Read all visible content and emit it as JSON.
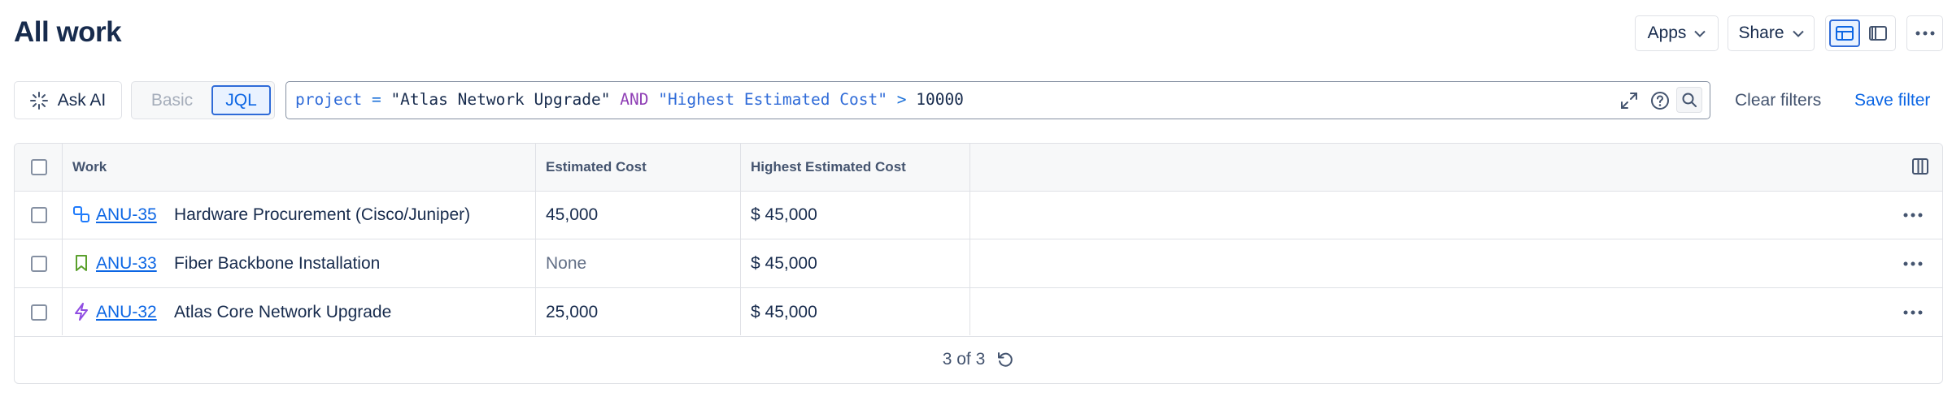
{
  "header": {
    "title": "All work",
    "apps_label": "Apps",
    "share_label": "Share"
  },
  "filter_bar": {
    "ask_ai_label": "Ask AI",
    "basic_label": "Basic",
    "jql_label": "JQL",
    "query": {
      "field1": "project",
      "op1": "=",
      "value1": "\"Atlas Network Upgrade\"",
      "conj": "AND",
      "field2": "\"Highest Estimated Cost\"",
      "op2": ">",
      "value2": "10000"
    },
    "clear_filters_label": "Clear filters",
    "save_filter_label": "Save filter"
  },
  "table": {
    "columns": [
      "Work",
      "Estimated Cost",
      "Highest Estimated Cost"
    ],
    "rows": [
      {
        "type_icon": "subtask-icon",
        "key": "ANU-35",
        "summary": "Hardware Procurement (Cisco/Juniper)",
        "estimated_cost": "45,000",
        "highest_estimated_cost": "$ 45,000"
      },
      {
        "type_icon": "story-icon",
        "key": "ANU-33",
        "summary": "Fiber Backbone Installation",
        "estimated_cost": "None",
        "highest_estimated_cost": "$ 45,000"
      },
      {
        "type_icon": "epic-icon",
        "key": "ANU-32",
        "summary": "Atlas Core Network Upgrade",
        "estimated_cost": "25,000",
        "highest_estimated_cost": "$ 45,000"
      }
    ],
    "count_label": "3 of 3"
  },
  "colors": {
    "link": "#0c66e4",
    "story_icon": "#5aa02c",
    "epic_icon": "#904ee2",
    "subtask_icon": "#1d7afc"
  }
}
